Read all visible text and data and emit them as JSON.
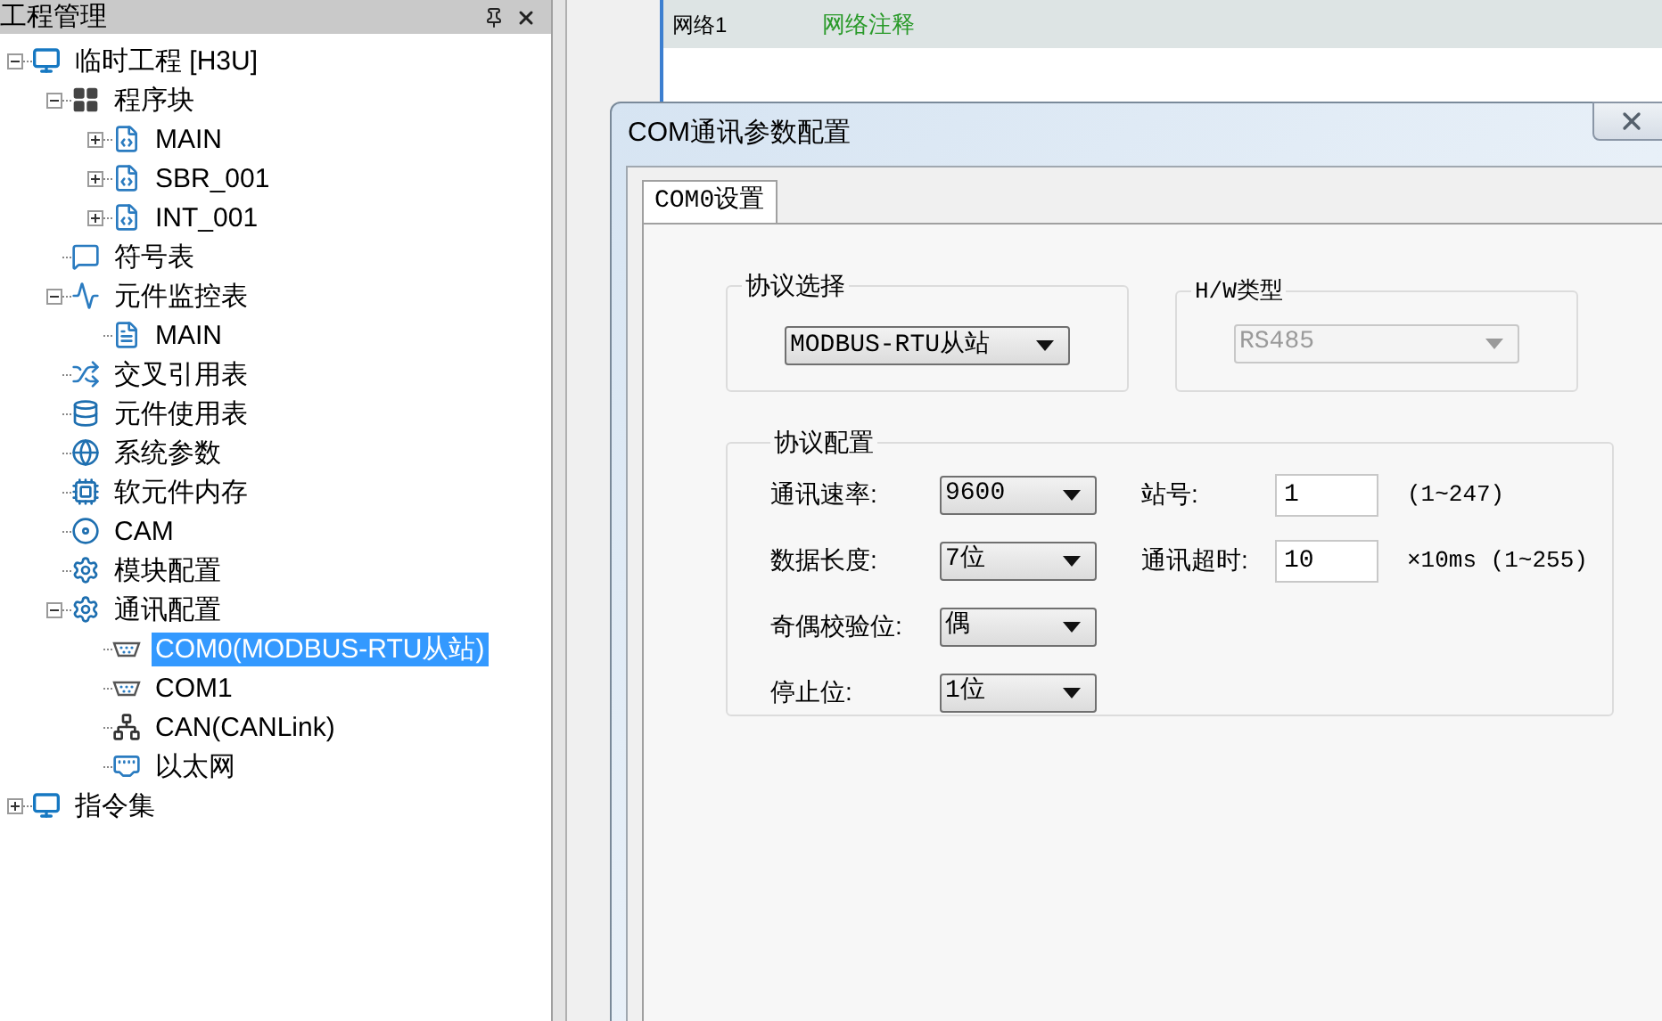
{
  "project_panel": {
    "title": "工程管理",
    "tree": [
      {
        "label": "临时工程 [H3U]",
        "kind": "monitor",
        "expanded": true,
        "selected": false,
        "children": [
          {
            "label": "程序块",
            "kind": "blocks",
            "expanded": true,
            "selected": false,
            "children": [
              {
                "label": "MAIN",
                "kind": "program",
                "expanded": false,
                "selected": false
              },
              {
                "label": "SBR_001",
                "kind": "program",
                "expanded": false,
                "selected": false
              },
              {
                "label": "INT_001",
                "kind": "program",
                "expanded": false,
                "selected": false
              }
            ]
          },
          {
            "label": "符号表",
            "kind": "comment",
            "selected": false
          },
          {
            "label": "元件监控表",
            "kind": "trend",
            "expanded": true,
            "selected": false,
            "children": [
              {
                "label": "MAIN",
                "kind": "document",
                "selected": false
              }
            ]
          },
          {
            "label": "交叉引用表",
            "kind": "cross",
            "selected": false
          },
          {
            "label": "元件使用表",
            "kind": "database",
            "selected": false
          },
          {
            "label": "系统参数",
            "kind": "globe",
            "selected": false
          },
          {
            "label": "软元件内存",
            "kind": "memory",
            "selected": false
          },
          {
            "label": "CAM",
            "kind": "cam",
            "selected": false
          },
          {
            "label": "模块配置",
            "kind": "config",
            "selected": false
          },
          {
            "label": "通讯配置",
            "kind": "config",
            "expanded": true,
            "selected": false,
            "children": [
              {
                "label": "COM0(MODBUS-RTU从站)",
                "kind": "port",
                "selected": true
              },
              {
                "label": "COM1",
                "kind": "port",
                "selected": false
              },
              {
                "label": "CAN(CANLink)",
                "kind": "network",
                "selected": false
              },
              {
                "label": "以太网",
                "kind": "ethernet",
                "selected": false
              }
            ]
          }
        ]
      },
      {
        "label": "指令集",
        "kind": "monitor",
        "expanded": false,
        "selected": false
      }
    ]
  },
  "editor": {
    "network_label": "网络1",
    "network_comment": "网络注释"
  },
  "dialog": {
    "title": "COM通讯参数配置",
    "tabs": [
      {
        "label": "COM0设置",
        "selected": true
      }
    ],
    "protocol_select": {
      "title": "协议选择",
      "value": "MODBUS-RTU从站",
      "disabled": false
    },
    "hw_type": {
      "title": "H/W类型",
      "value": "RS485",
      "disabled": true
    },
    "protocol_config": {
      "title": "协议配置",
      "rows": [
        {
          "label": "通讯速率:",
          "value": "9600",
          "right": {
            "label": "站号:",
            "value": "1",
            "hint": "(1~247)"
          }
        },
        {
          "label": "数据长度:",
          "value": "7位",
          "right": {
            "label": "通讯超时:",
            "value": "10",
            "hint": "×10ms (1~255)"
          }
        },
        {
          "label": "奇偶校验位:",
          "value": "偶"
        },
        {
          "label": "停止位:",
          "value": "1位"
        }
      ]
    }
  }
}
